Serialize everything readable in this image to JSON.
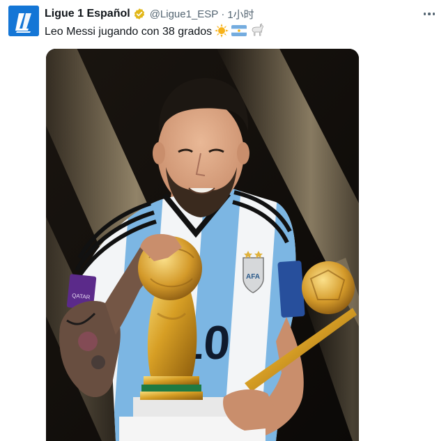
{
  "account": {
    "display_name": "Ligue 1 Español",
    "handle": "@Ligue1_ESP",
    "separator": "·",
    "time": "1小时",
    "avatar_icon": "ligue1-logo-icon",
    "verified_icon": "verified-gold-badge-icon"
  },
  "tweet": {
    "text": "Leo Messi jugando con 38 grados",
    "emojis": [
      "sun-emoji-icon",
      "argentina-flag-emoji-icon",
      "goat-emoji-icon"
    ]
  },
  "more_icon": "more-dots-icon",
  "colors": {
    "avatar_bg": "#1476d6",
    "verified": "#e2b719",
    "handle": "#536471",
    "text": "#0f1419"
  },
  "media": {
    "jersey_number": "10"
  }
}
